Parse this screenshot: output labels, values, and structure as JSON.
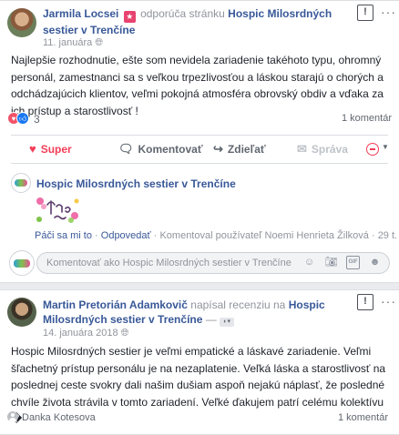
{
  "post1": {
    "author": "Jarmila Locsei",
    "action": "odporúča stránku",
    "page": "Hospic Milosrdných sestier v Trenčíne",
    "time": "11. januára",
    "text": "Najlepšie rozhodnutie, ešte som nevidela zariadenie takéhoto typu, ohromný personál, zamestnanci sa s veľkou trpezlivosťou a láskou starajú o chorých a odchádzajúcich klientov, veľmi pokojná atmosféra obrovský obdiv a vďaka za ich prístup a starostlivosť !",
    "reaction_count": "3",
    "comment_count": "1 komentár",
    "actions": [
      "Super",
      "Komentovať",
      "Zdieľať",
      "Správa"
    ]
  },
  "reply": {
    "author": "Hospic Milosrdných sestier v Trenčíne",
    "like": "Páči sa mi to",
    "reply": "Odpovedať",
    "note": "Komentoval používateľ Noemi Henrieta Žilková",
    "time": "29 t."
  },
  "comment_input": {
    "placeholder": "Komentovať ako Hospic Milosrdných sestier v Trenčíne"
  },
  "post2": {
    "author": "Martin Pretorián Adamkovič",
    "action": "napísal recenziu na",
    "page": "Hospic Milosrdných sestier v Trenčíne",
    "separator": "—",
    "time": "14. januára 2018",
    "text": "Hospic Milosrdných sestier je veľmi empatické a láskavé zariadenie. Veľmi šľachetný prístup personálu je na nezaplatenie. Veľká láska a starostlivosť na poslednej ceste svokry dali našim dušiam aspoň nejakú náplasť, že posledné chvíle života strávila v tomto zariadení. Veľké ďakujem patrí celému kolektívu �",
    "reactor": "Danka Kotesova",
    "comment_count": "1 komentár"
  },
  "colors": {
    "link": "#385898",
    "super": "#f33e58",
    "muted": "#90949c"
  }
}
